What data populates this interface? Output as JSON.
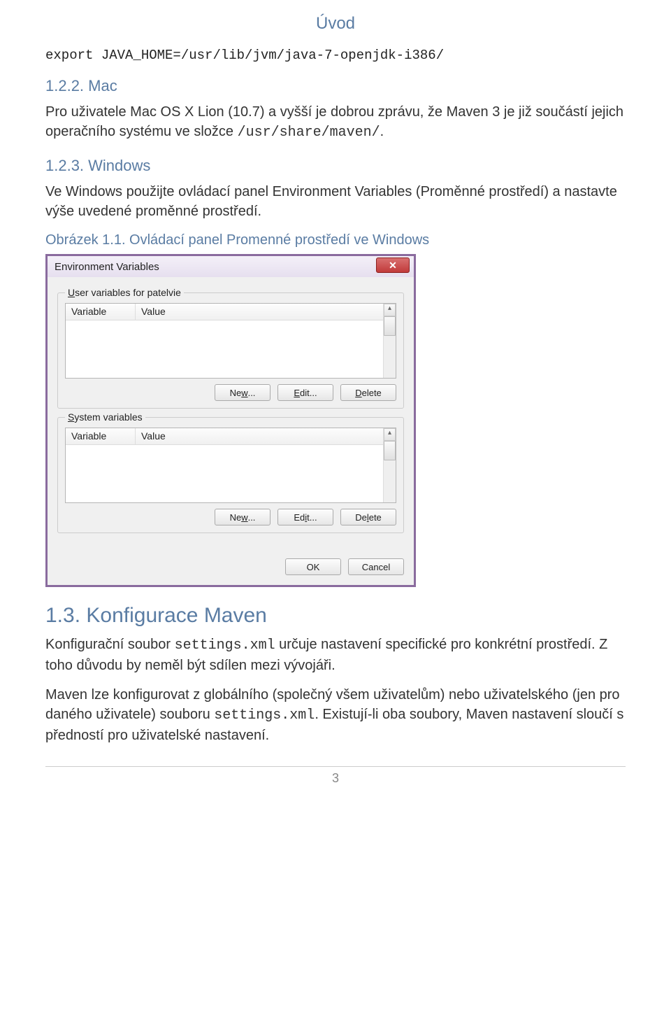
{
  "page": {
    "header": "Úvod",
    "number": "3"
  },
  "intro": {
    "code_line": "export JAVA_HOME=/usr/lib/jvm/java-7-openjdk-i386/",
    "mac_heading": "1.2.2. Mac",
    "mac_body_pre": "Pro uživatele Mac OS X Lion (10.7) a vyšší je dobrou zprávu, že Maven 3 je již součástí jejich operačního systému ve složce ",
    "mac_body_code": "/usr/share/maven/",
    "mac_body_post": ".",
    "win_heading": "1.2.3. Windows",
    "win_body": "Ve Windows použijte ovládací panel Environment Variables (Proměnné prostředí) a nastavte výše uvedené proměnné prostředí.",
    "figure_caption": "Obrázek 1.1. Ovládací panel Promenné prostředí ve Windows"
  },
  "dialog": {
    "title": "Environment Variables",
    "close_glyph": "✕",
    "user_group": "User variables for patelvie",
    "system_group": "System variables",
    "col_variable": "Variable",
    "col_value": "Value",
    "btn_new_u": "New...",
    "btn_edit_u": "Edit...",
    "btn_delete_u": "Delete",
    "btn_new_s": "New...",
    "btn_edit_s": "Edit...",
    "btn_delete_s": "Delete",
    "btn_ok": "OK",
    "btn_cancel": "Cancel",
    "scroll_up": "▴",
    "scroll_down": "▾"
  },
  "config": {
    "heading": "1.3. Konfigurace Maven",
    "p1_pre": "Konfigurační soubor ",
    "p1_code": "settings.xml",
    "p1_post": " určuje nastavení specifické pro konkrétní prostředí. Z toho důvodu by neměl být sdílen mezi vývojáři.",
    "p2_pre": "Maven lze konfigurovat z globálního (společný všem uživatelům) nebo uživatelského (jen pro daného uživatele) souboru ",
    "p2_code": "settings.xml",
    "p2_post": ". Existují-li oba soubory, Maven nastavení sloučí s předností pro uživatelské nastavení."
  }
}
